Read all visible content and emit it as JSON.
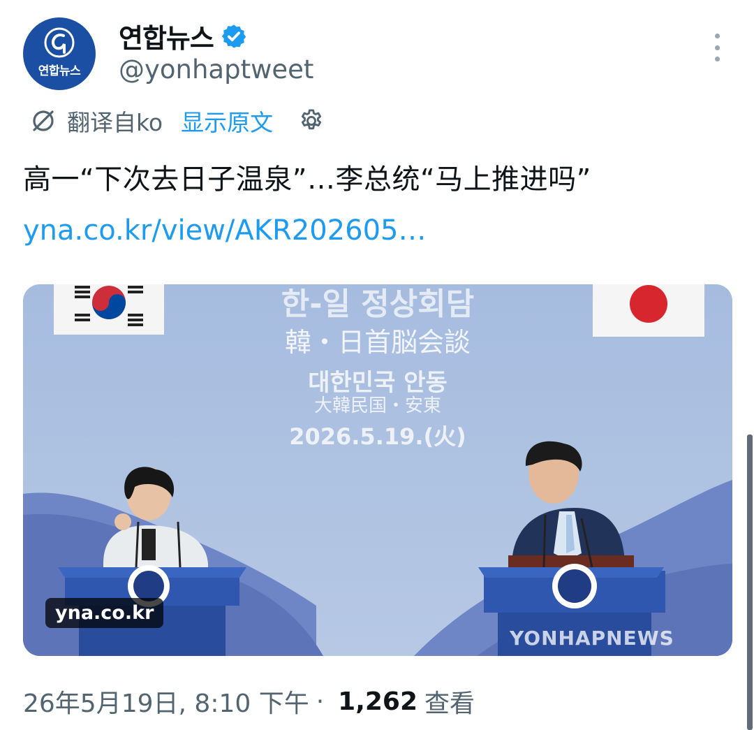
{
  "account": {
    "display_name": "연합뉴스",
    "handle": "@yonhaptweet",
    "avatar_text": "연합뉴스",
    "verified": true,
    "brand_color": "#1a4fa3"
  },
  "translation": {
    "label": "翻译自ko",
    "show_original": "显示原文",
    "icon": "translate-icon",
    "settings_icon": "gear-icon"
  },
  "tweet": {
    "text": "高一“下次去日子温泉”…李总统“马上推进吗”",
    "link": "yna.co.kr/view/AKR202605…"
  },
  "media": {
    "banner_ko_title": "한-일 정상회담",
    "banner_cn_title": "韓・日首脳会談",
    "banner_ko_place": "대한민국 안동",
    "banner_cn_place": "大韓民国・安東",
    "banner_date": "2026.5.19.(火)",
    "source_badge": "yna.co.kr",
    "watermark": "YONHAPNEWS"
  },
  "meta": {
    "timestamp": "26年5月19日, 8:10 下午",
    "separator": "·",
    "views_count": "1,262",
    "views_label": "查看"
  },
  "colors": {
    "link": "#1d9bf0",
    "secondary_text": "#536471",
    "primary_text": "#0f1419"
  }
}
